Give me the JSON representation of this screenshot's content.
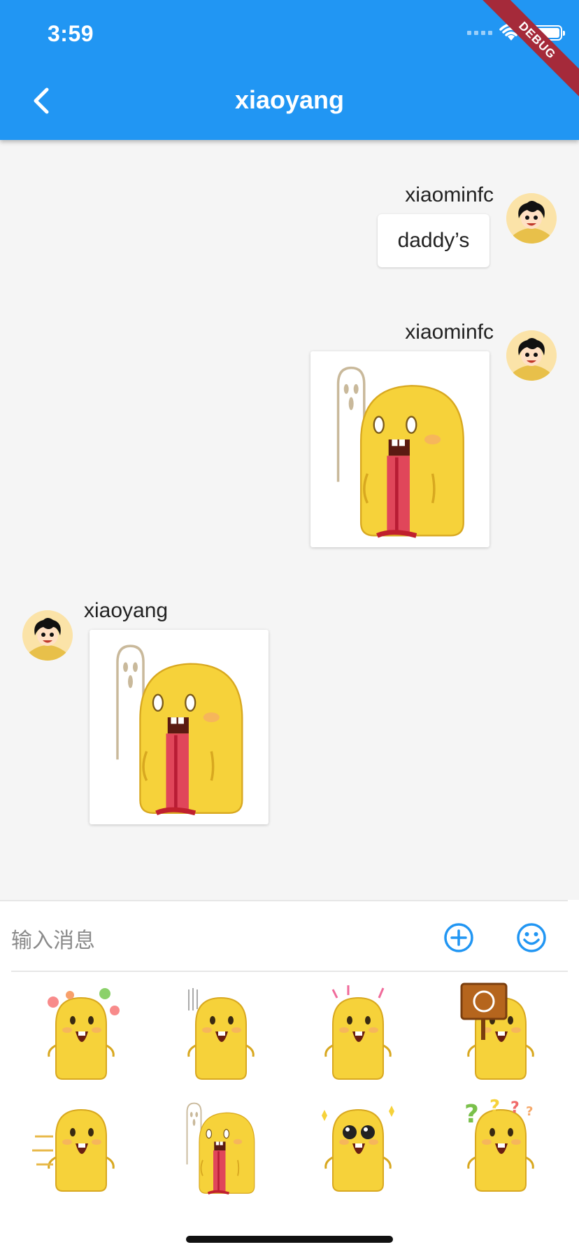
{
  "status_bar": {
    "time": "3:59"
  },
  "appbar": {
    "title": "xiaoyang",
    "debug_label": "DEBUG"
  },
  "messages": [
    {
      "sender": "xiaominfc",
      "side": "right",
      "type": "text",
      "text": "daddy’s"
    },
    {
      "sender": "xiaominfc",
      "side": "right",
      "type": "image"
    },
    {
      "sender": "xiaoyang",
      "side": "left",
      "type": "image"
    }
  ],
  "input": {
    "placeholder": "输入消息"
  },
  "stickers": [
    {
      "name": "flower-blob-sticker"
    },
    {
      "name": "shocked-blob-sticker"
    },
    {
      "name": "excited-blob-sticker"
    },
    {
      "name": "sign-blob-sticker"
    },
    {
      "name": "dashing-blob-sticker"
    },
    {
      "name": "ghost-blob-sticker"
    },
    {
      "name": "sparkle-eyes-blob-sticker"
    },
    {
      "name": "question-blob-sticker"
    }
  ],
  "colors": {
    "appbar": "#2196f3",
    "accent": "#2196f3",
    "background": "#f5f5f5",
    "blob": "#f6d23a"
  }
}
